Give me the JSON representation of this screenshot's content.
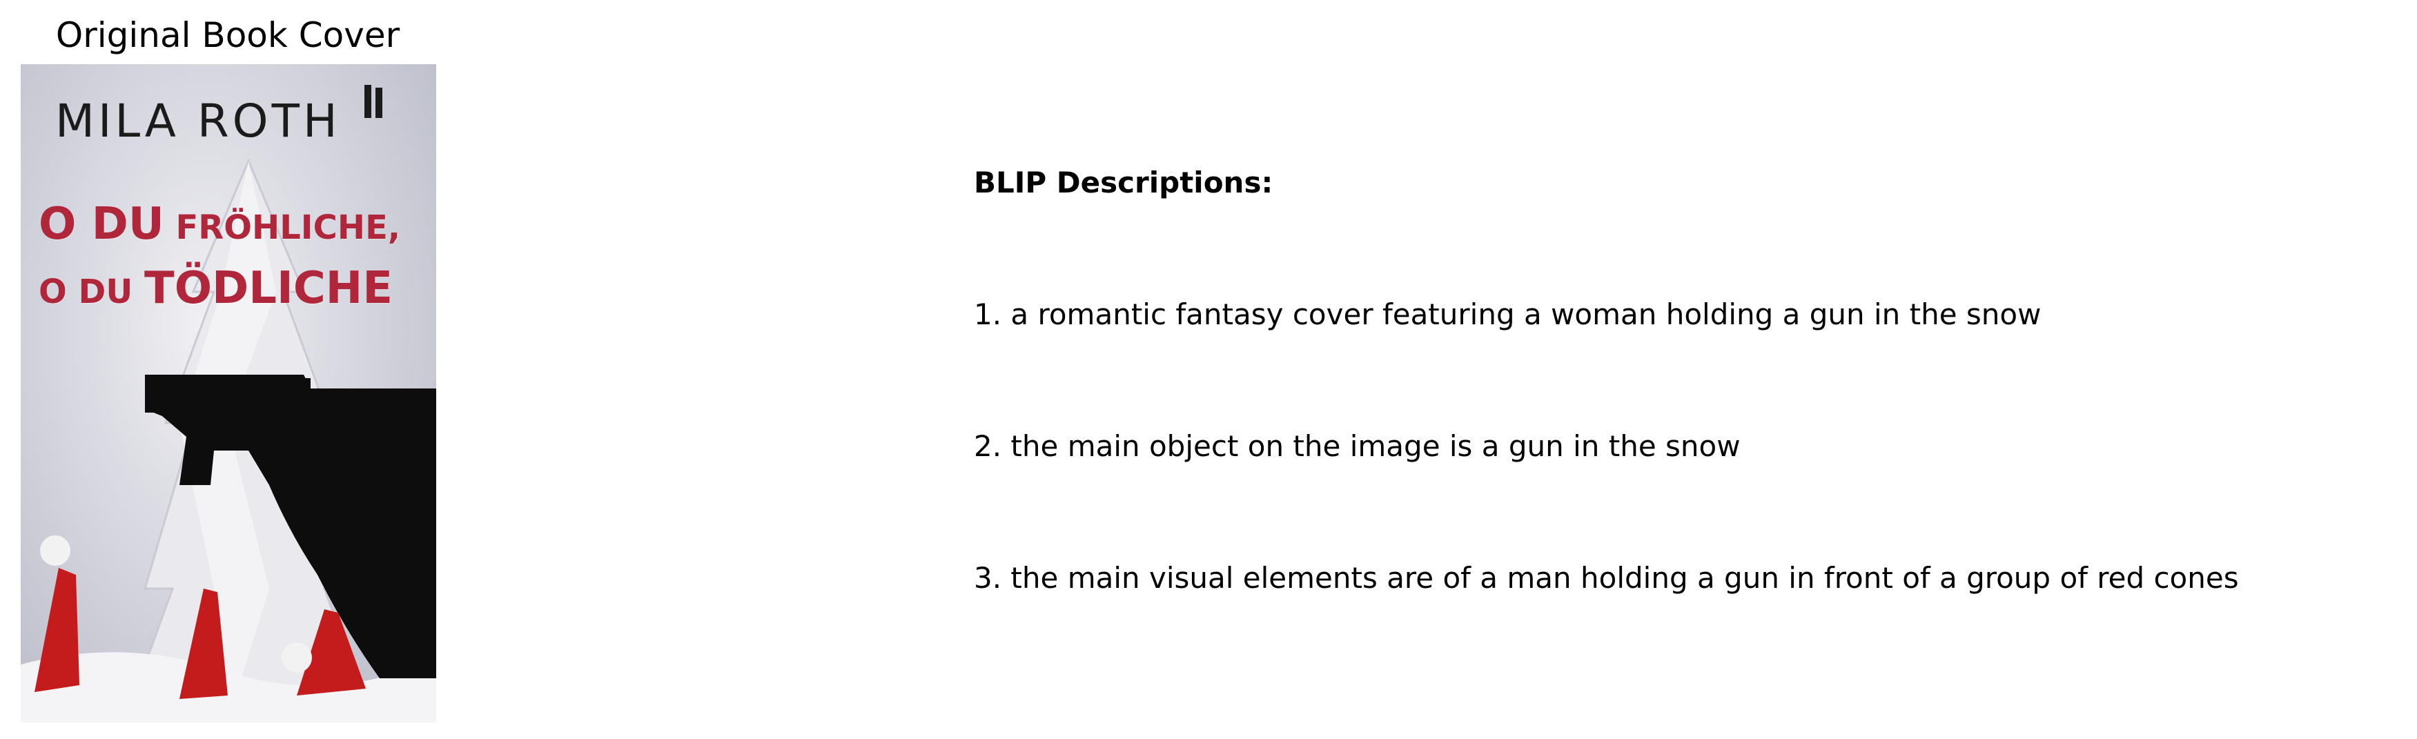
{
  "panel_title": "Original Book Cover",
  "cover": {
    "author": "MILA ROTH",
    "title_line1_big": "O DU",
    "title_line1_small": " FRÖHLICHE,",
    "title_line2_small": "O DU ",
    "title_line2_big": "TÖDLICHE",
    "colors": {
      "title_red": "#b0263a",
      "hat_red": "#c41c1c",
      "silhouette": "#0d0d0d"
    }
  },
  "blip": {
    "heading": "BLIP Descriptions:",
    "descriptions": [
      "1. a romantic fantasy cover featuring a woman holding a gun in the snow",
      "2. the main object on the image is a gun in the snow",
      "3. the main visual elements are of a man holding a gun in front of a group of red cones"
    ]
  }
}
